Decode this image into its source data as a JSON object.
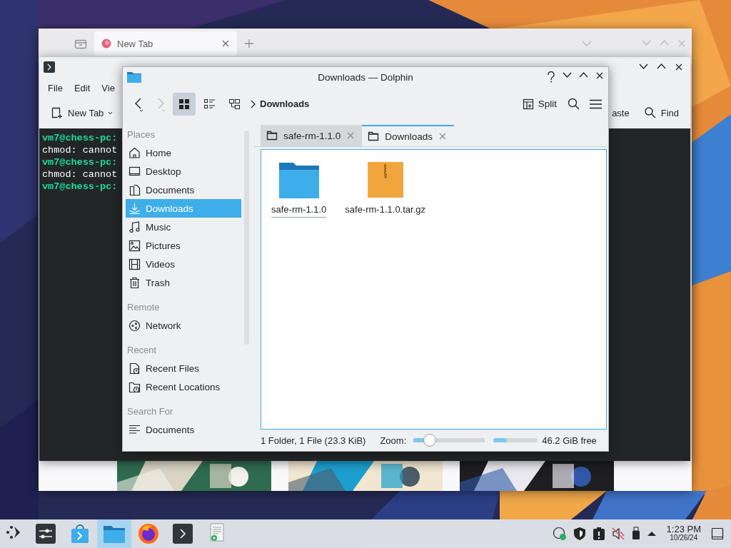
{
  "firefox": {
    "tab": {
      "label": "New Tab"
    }
  },
  "konsole": {
    "menu": [
      "File",
      "Edit",
      "Vie"
    ],
    "toolbar": [
      {
        "label": "New Tab"
      },
      {
        "label": "aste"
      },
      {
        "label": "Find"
      }
    ],
    "lines": [
      {
        "kind": "prompt",
        "text": "vm7@chess-pc:"
      },
      {
        "kind": "output",
        "text": "chmod: cannot"
      },
      {
        "kind": "prompt",
        "text": "vm7@chess-pc:"
      },
      {
        "kind": "output",
        "text": "chmod: cannot"
      },
      {
        "kind": "prompt",
        "text": "vm7@chess-pc:"
      }
    ]
  },
  "dolphin": {
    "title": "Downloads — Dolphin",
    "breadcrumb": "Downloads",
    "split": "Split",
    "view_modes": [
      {
        "selected": true
      },
      {
        "selected": false
      },
      {
        "selected": false
      }
    ],
    "sections": [
      {
        "title": "Places",
        "items": [
          {
            "label": "Home",
            "selected": false
          },
          {
            "label": "Desktop",
            "selected": false
          },
          {
            "label": "Documents",
            "selected": false
          },
          {
            "label": "Downloads",
            "selected": true
          },
          {
            "label": "Music",
            "selected": false
          },
          {
            "label": "Pictures",
            "selected": false
          },
          {
            "label": "Videos",
            "selected": false
          },
          {
            "label": "Trash",
            "selected": false
          }
        ]
      },
      {
        "title": "Remote",
        "items": [
          {
            "label": "Network",
            "selected": false
          }
        ]
      },
      {
        "title": "Recent",
        "items": [
          {
            "label": "Recent Files",
            "selected": false
          },
          {
            "label": "Recent Locations",
            "selected": false
          }
        ]
      },
      {
        "title": "Search For",
        "items": [
          {
            "label": "Documents",
            "selected": false
          }
        ]
      }
    ],
    "tabs": [
      {
        "label": "safe-rm-1.1.0",
        "selected": false
      },
      {
        "label": "Downloads",
        "selected": true
      }
    ],
    "files": [
      {
        "kind": "folder",
        "name": "safe-rm-1.1.0",
        "focused": true
      },
      {
        "kind": "archive",
        "name": "safe-rm-1.1.0.tar.gz",
        "focused": false
      }
    ],
    "status": "1 Folder, 1 File (23.3 KiB)",
    "zoom_label": "Zoom:",
    "zoom": {
      "level": 0.23
    },
    "space": {
      "level": 0.3,
      "reading": "46.2 GiB free"
    }
  },
  "taskbar": {
    "tasks": [
      {
        "selected": false
      },
      {
        "selected": false
      },
      {
        "selected": false
      },
      {
        "selected": true
      },
      {
        "selected": false
      },
      {
        "selected": false
      },
      {
        "selected": false
      }
    ],
    "time": "1:23 PM",
    "date": "10/26/24"
  }
}
